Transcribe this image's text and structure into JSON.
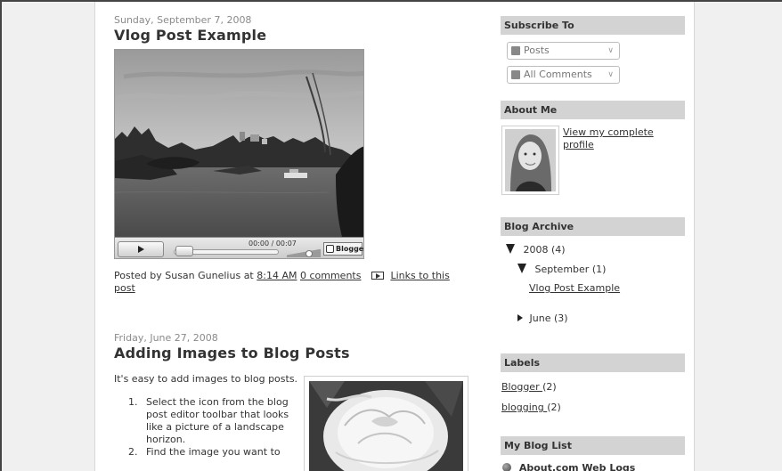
{
  "post1": {
    "date": "Sunday, September 7, 2008",
    "title": "Vlog Post Example",
    "video": {
      "time": "00:00 / 00:07",
      "brand": "Blogger"
    },
    "footer": {
      "posted_by": "Posted by Susan Gunelius at",
      "time": "8:14 AM",
      "comments": "0 comments",
      "links_a": "Links to this",
      "links_b": "post"
    }
  },
  "post2": {
    "date": "Friday, June 27, 2008",
    "title": "Adding Images to Blog Posts",
    "intro": "It's easy to add images to blog posts.",
    "steps": [
      "Select the icon from the blog post editor toolbar that looks like a picture of a landscape horizon.",
      "Find the image you want to"
    ]
  },
  "sidebar": {
    "subscribe": {
      "heading": "Subscribe To",
      "posts": "Posts",
      "comments": "All Comments"
    },
    "about": {
      "heading": "About Me",
      "profile_link_a": "View my complete",
      "profile_link_b": "profile"
    },
    "archive": {
      "heading": "Blog Archive",
      "year": "2008",
      "year_count": "(4)",
      "month": "September",
      "month_count": "(1)",
      "post_link": "Vlog Post Example",
      "month2": "June",
      "month2_count": "(3)"
    },
    "labels": {
      "heading": "Labels",
      "items": [
        {
          "name": "Blogger ",
          "count": "(2)"
        },
        {
          "name": "blogging ",
          "count": "(2)"
        }
      ]
    },
    "bloglist": {
      "heading": "My Blog List",
      "first": "About.com Web Logs"
    }
  },
  "colors": {
    "sidebar_heading_bg": "#d3d3d3",
    "gutter_bg": "#f0f0f0",
    "text": "#333333",
    "date_text": "#8a8a8a"
  }
}
